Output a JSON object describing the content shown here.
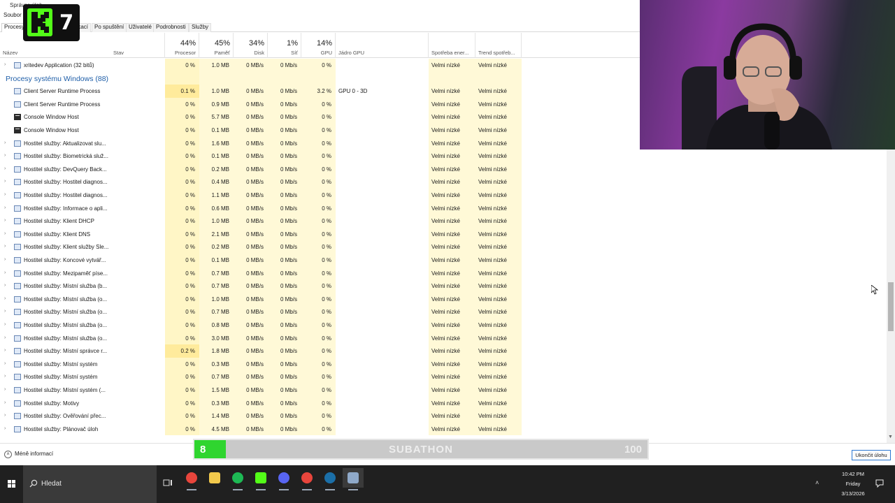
{
  "window": {
    "title": "Správce úloh",
    "menu": [
      "Soubor"
    ],
    "tabs": [
      {
        "label": "Procesy"
      },
      {
        "label": "Historie aplikací"
      },
      {
        "label": "Po spuštění"
      },
      {
        "label": "Uživatelé"
      },
      {
        "label": "Podrobnosti"
      },
      {
        "label": "Služby"
      }
    ]
  },
  "overlay": {
    "logo_number": "7",
    "subathon": {
      "title": "SUBATHON",
      "left": "8",
      "right": "100",
      "progress": 0.07
    }
  },
  "columns": {
    "name": "Název",
    "status": "Stav",
    "cpu": {
      "pct": "44%",
      "label": "Procesor"
    },
    "mem": {
      "pct": "45%",
      "label": "Paměť"
    },
    "disk": {
      "pct": "34%",
      "label": "Disk"
    },
    "net": {
      "pct": "1%",
      "label": "Síť"
    },
    "gpu": {
      "pct": "14%",
      "label": "GPU"
    },
    "gpu_engine": "Jádro GPU",
    "power": "Spotřeba ener...",
    "power_trend": "Trend spotřeb..."
  },
  "rows": [
    {
      "type": "proc",
      "expand": true,
      "icon": "app",
      "name": "xritedev Application (32 bitů)",
      "cpu": "0 %",
      "mem": "1.0 MB",
      "disk": "0 MB/s",
      "net": "0 Mb/s",
      "gpu": "0 %",
      "engine": "",
      "power": "Velmi nízké",
      "trend": "Velmi nízké"
    },
    {
      "type": "group",
      "name": "Procesy systému Windows (88)"
    },
    {
      "type": "proc",
      "expand": false,
      "icon": "app",
      "name": "Client Server Runtime Process",
      "cpu": "0.1 %",
      "mem": "1.0 MB",
      "disk": "0 MB/s",
      "net": "0 Mb/s",
      "gpu": "3.2 %",
      "engine": "GPU 0 - 3D",
      "power": "Velmi nízké",
      "trend": "Velmi nízké"
    },
    {
      "type": "proc",
      "expand": false,
      "icon": "app",
      "name": "Client Server Runtime Process",
      "cpu": "0 %",
      "mem": "0.9 MB",
      "disk": "0 MB/s",
      "net": "0 Mb/s",
      "gpu": "0 %",
      "engine": "",
      "power": "Velmi nízké",
      "trend": "Velmi nízké"
    },
    {
      "type": "proc",
      "expand": false,
      "icon": "console",
      "name": "Console Window Host",
      "cpu": "0 %",
      "mem": "5.7 MB",
      "disk": "0 MB/s",
      "net": "0 Mb/s",
      "gpu": "0 %",
      "engine": "",
      "power": "Velmi nízké",
      "trend": "Velmi nízké"
    },
    {
      "type": "proc",
      "expand": false,
      "icon": "console",
      "name": "Console Window Host",
      "cpu": "0 %",
      "mem": "0.1 MB",
      "disk": "0 MB/s",
      "net": "0 Mb/s",
      "gpu": "0 %",
      "engine": "",
      "power": "Velmi nízké",
      "trend": "Velmi nízké"
    },
    {
      "type": "proc",
      "expand": true,
      "icon": "app",
      "name": "Hostitel služby: Aktualizovat slu...",
      "cpu": "0 %",
      "mem": "1.6 MB",
      "disk": "0 MB/s",
      "net": "0 Mb/s",
      "gpu": "0 %",
      "engine": "",
      "power": "Velmi nízké",
      "trend": "Velmi nízké"
    },
    {
      "type": "proc",
      "expand": true,
      "icon": "app",
      "name": "Hostitel služby: Biometrická služ...",
      "cpu": "0 %",
      "mem": "0.1 MB",
      "disk": "0 MB/s",
      "net": "0 Mb/s",
      "gpu": "0 %",
      "engine": "",
      "power": "Velmi nízké",
      "trend": "Velmi nízké"
    },
    {
      "type": "proc",
      "expand": true,
      "icon": "app",
      "name": "Hostitel služby: DevQuery Back...",
      "cpu": "0 %",
      "mem": "0.2 MB",
      "disk": "0 MB/s",
      "net": "0 Mb/s",
      "gpu": "0 %",
      "engine": "",
      "power": "Velmi nízké",
      "trend": "Velmi nízké"
    },
    {
      "type": "proc",
      "expand": true,
      "icon": "app",
      "name": "Hostitel služby: Hostitel diagnos...",
      "cpu": "0 %",
      "mem": "0.4 MB",
      "disk": "0 MB/s",
      "net": "0 Mb/s",
      "gpu": "0 %",
      "engine": "",
      "power": "Velmi nízké",
      "trend": "Velmi nízké"
    },
    {
      "type": "proc",
      "expand": true,
      "icon": "app",
      "name": "Hostitel služby: Hostitel diagnos...",
      "cpu": "0 %",
      "mem": "1.1 MB",
      "disk": "0 MB/s",
      "net": "0 Mb/s",
      "gpu": "0 %",
      "engine": "",
      "power": "Velmi nízké",
      "trend": "Velmi nízké"
    },
    {
      "type": "proc",
      "expand": true,
      "icon": "app",
      "name": "Hostitel služby: Informace o apli...",
      "cpu": "0 %",
      "mem": "0.6 MB",
      "disk": "0 MB/s",
      "net": "0 Mb/s",
      "gpu": "0 %",
      "engine": "",
      "power": "Velmi nízké",
      "trend": "Velmi nízké"
    },
    {
      "type": "proc",
      "expand": true,
      "icon": "app",
      "name": "Hostitel služby: Klient DHCP",
      "cpu": "0 %",
      "mem": "1.0 MB",
      "disk": "0 MB/s",
      "net": "0 Mb/s",
      "gpu": "0 %",
      "engine": "",
      "power": "Velmi nízké",
      "trend": "Velmi nízké"
    },
    {
      "type": "proc",
      "expand": true,
      "icon": "app",
      "name": "Hostitel služby: Klient DNS",
      "cpu": "0 %",
      "mem": "2.1 MB",
      "disk": "0 MB/s",
      "net": "0 Mb/s",
      "gpu": "0 %",
      "engine": "",
      "power": "Velmi nízké",
      "trend": "Velmi nízké"
    },
    {
      "type": "proc",
      "expand": true,
      "icon": "app",
      "name": "Hostitel služby: Klient služby Sle...",
      "cpu": "0 %",
      "mem": "0.2 MB",
      "disk": "0 MB/s",
      "net": "0 Mb/s",
      "gpu": "0 %",
      "engine": "",
      "power": "Velmi nízké",
      "trend": "Velmi nízké"
    },
    {
      "type": "proc",
      "expand": true,
      "icon": "app",
      "name": "Hostitel služby: Koncové vytvář...",
      "cpu": "0 %",
      "mem": "0.1 MB",
      "disk": "0 MB/s",
      "net": "0 Mb/s",
      "gpu": "0 %",
      "engine": "",
      "power": "Velmi nízké",
      "trend": "Velmi nízké"
    },
    {
      "type": "proc",
      "expand": true,
      "icon": "app",
      "name": "Hostitel služby: Mezipaměť píse...",
      "cpu": "0 %",
      "mem": "0.7 MB",
      "disk": "0 MB/s",
      "net": "0 Mb/s",
      "gpu": "0 %",
      "engine": "",
      "power": "Velmi nízké",
      "trend": "Velmi nízké"
    },
    {
      "type": "proc",
      "expand": true,
      "icon": "app",
      "name": "Hostitel služby: Místní služba (b...",
      "cpu": "0 %",
      "mem": "0.7 MB",
      "disk": "0 MB/s",
      "net": "0 Mb/s",
      "gpu": "0 %",
      "engine": "",
      "power": "Velmi nízké",
      "trend": "Velmi nízké"
    },
    {
      "type": "proc",
      "expand": true,
      "icon": "app",
      "name": "Hostitel služby: Místní služba (o...",
      "cpu": "0 %",
      "mem": "1.0 MB",
      "disk": "0 MB/s",
      "net": "0 Mb/s",
      "gpu": "0 %",
      "engine": "",
      "power": "Velmi nízké",
      "trend": "Velmi nízké"
    },
    {
      "type": "proc",
      "expand": true,
      "icon": "app",
      "name": "Hostitel služby: Místní služba (o...",
      "cpu": "0 %",
      "mem": "0.7 MB",
      "disk": "0 MB/s",
      "net": "0 Mb/s",
      "gpu": "0 %",
      "engine": "",
      "power": "Velmi nízké",
      "trend": "Velmi nízké"
    },
    {
      "type": "proc",
      "expand": true,
      "icon": "app",
      "name": "Hostitel služby: Místní služba (o...",
      "cpu": "0 %",
      "mem": "0.8 MB",
      "disk": "0 MB/s",
      "net": "0 Mb/s",
      "gpu": "0 %",
      "engine": "",
      "power": "Velmi nízké",
      "trend": "Velmi nízké"
    },
    {
      "type": "proc",
      "expand": true,
      "icon": "app",
      "name": "Hostitel služby: Místní služba (o...",
      "cpu": "0 %",
      "mem": "3.0 MB",
      "disk": "0 MB/s",
      "net": "0 Mb/s",
      "gpu": "0 %",
      "engine": "",
      "power": "Velmi nízké",
      "trend": "Velmi nízké"
    },
    {
      "type": "proc",
      "expand": true,
      "icon": "app",
      "name": "Hostitel služby: Místní správce r...",
      "cpu": "0.2 %",
      "mem": "1.8 MB",
      "disk": "0 MB/s",
      "net": "0 Mb/s",
      "gpu": "0 %",
      "engine": "",
      "power": "Velmi nízké",
      "trend": "Velmi nízké"
    },
    {
      "type": "proc",
      "expand": true,
      "icon": "app",
      "name": "Hostitel služby: Místní systém",
      "cpu": "0 %",
      "mem": "0.3 MB",
      "disk": "0 MB/s",
      "net": "0 Mb/s",
      "gpu": "0 %",
      "engine": "",
      "power": "Velmi nízké",
      "trend": "Velmi nízké"
    },
    {
      "type": "proc",
      "expand": true,
      "icon": "app",
      "name": "Hostitel služby: Místní systém",
      "cpu": "0 %",
      "mem": "0.7 MB",
      "disk": "0 MB/s",
      "net": "0 Mb/s",
      "gpu": "0 %",
      "engine": "",
      "power": "Velmi nízké",
      "trend": "Velmi nízké"
    },
    {
      "type": "proc",
      "expand": true,
      "icon": "app",
      "name": "Hostitel služby: Místní systém (...",
      "cpu": "0 %",
      "mem": "1.5 MB",
      "disk": "0 MB/s",
      "net": "0 Mb/s",
      "gpu": "0 %",
      "engine": "",
      "power": "Velmi nízké",
      "trend": "Velmi nízké"
    },
    {
      "type": "proc",
      "expand": true,
      "icon": "app",
      "name": "Hostitel služby: Motivy",
      "cpu": "0 %",
      "mem": "0.3 MB",
      "disk": "0 MB/s",
      "net": "0 Mb/s",
      "gpu": "0 %",
      "engine": "",
      "power": "Velmi nízké",
      "trend": "Velmi nízké"
    },
    {
      "type": "proc",
      "expand": true,
      "icon": "app",
      "name": "Hostitel služby: Ověřování přec...",
      "cpu": "0 %",
      "mem": "1.4 MB",
      "disk": "0 MB/s",
      "net": "0 Mb/s",
      "gpu": "0 %",
      "engine": "",
      "power": "Velmi nízké",
      "trend": "Velmi nízké"
    },
    {
      "type": "proc",
      "expand": true,
      "icon": "app",
      "name": "Hostitel služby: Plánovač úloh",
      "cpu": "0 %",
      "mem": "4.5 MB",
      "disk": "0 MB/s",
      "net": "0 Mb/s",
      "gpu": "0 %",
      "engine": "",
      "power": "Velmi nízké",
      "trend": "Velmi nízké"
    }
  ],
  "footer": {
    "less_info": "Méně informací",
    "end_task": "Ukončit úlohu"
  },
  "taskbar": {
    "search_label": "Hledat",
    "apps": [
      {
        "name": "chrome",
        "color": "#e8453c"
      },
      {
        "name": "file-explorer",
        "color": "#f2c94c"
      },
      {
        "name": "spotify",
        "color": "#1db954"
      },
      {
        "name": "kick-app",
        "color": "#53fc18"
      },
      {
        "name": "discord",
        "color": "#5865f2"
      },
      {
        "name": "chrome-2",
        "color": "#e8453c"
      },
      {
        "name": "steam",
        "color": "#1b6fa8"
      },
      {
        "name": "task-manager",
        "color": "#8fa9c9"
      }
    ],
    "time": "10:42 PM",
    "day": "Friday",
    "date": "3/13/2026"
  },
  "colors": {
    "accent": "#1e5ea8",
    "cpu_highlight": "#fff6c6",
    "kick_green": "#53fc18",
    "subathon_fill": "#2fd52f"
  }
}
